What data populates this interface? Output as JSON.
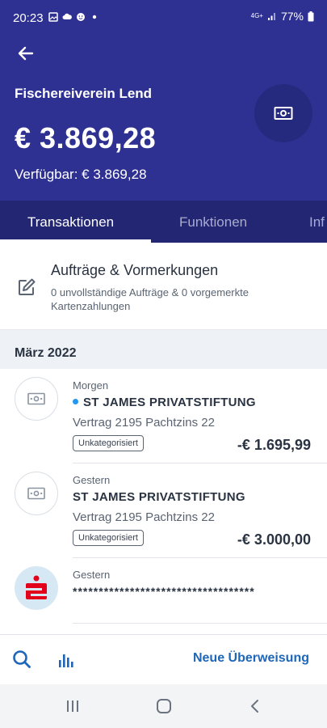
{
  "status_bar": {
    "time": "20:23",
    "network": "4G+",
    "battery": "77%",
    "left_icons": [
      "image-icon",
      "cloud-icon",
      "face-icon",
      "dot-icon"
    ]
  },
  "header": {
    "account_name": "Fischereiverein Lend",
    "balance": "€ 3.869,28",
    "available": "Verfügbar: € 3.869,28",
    "background_color": "#2e3192"
  },
  "tabs": [
    {
      "label": "Transaktionen",
      "active": true
    },
    {
      "label": "Funktionen",
      "active": false
    },
    {
      "label": "Inf",
      "active": false
    }
  ],
  "orders": {
    "title": "Aufträge & Vormerkungen",
    "subtitle": "0 unvollständige Aufträge & 0 vorgemerkte Kartenzahlungen"
  },
  "month": "März 2022",
  "transactions": [
    {
      "date": "Morgen",
      "name": "ST JAMES PRIVATSTIFTUNG",
      "pending_dot": true,
      "description": "Vertrag 2195 Pachtzins 22",
      "badge": "Unkategorisiert",
      "amount": "-€ 1.695,99"
    },
    {
      "date": "Gestern",
      "name": "ST JAMES PRIVATSTIFTUNG",
      "pending_dot": false,
      "description": "Vertrag 2195 Pachtzins 22",
      "badge": "Unkategorisiert",
      "amount": "-€ 3.000,00"
    },
    {
      "date": "Gestern",
      "name": "***********************************"
    }
  ],
  "bottom_bar": {
    "new_transfer": "Neue Überweisung",
    "accent_color": "#1e66b8"
  }
}
